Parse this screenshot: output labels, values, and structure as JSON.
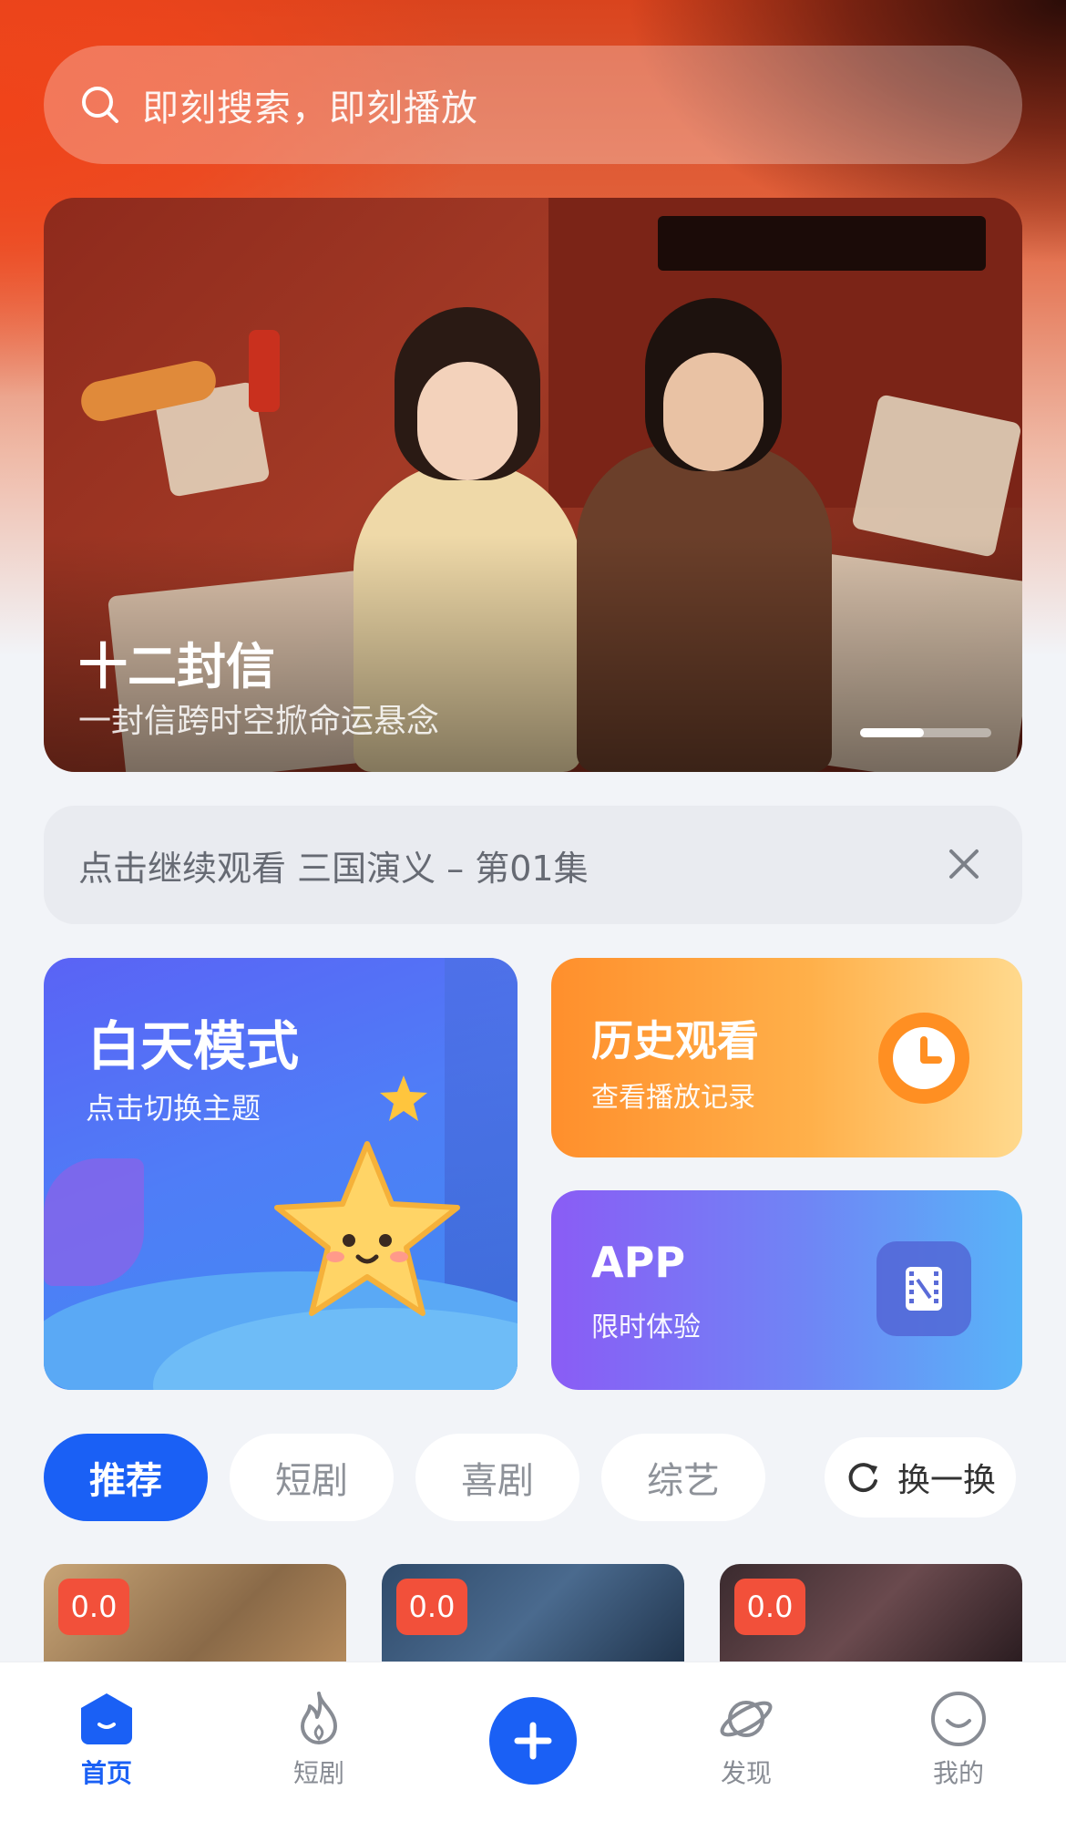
{
  "search": {
    "placeholder": "即刻搜索，即刻播放"
  },
  "banner": {
    "title": "十二封信",
    "subtitle": "一封信跨时空掀命运悬念"
  },
  "resume": {
    "text": "点击继续观看 三国演义 – 第01集"
  },
  "cards": {
    "theme": {
      "title": "白天模式",
      "subtitle": "点击切换主题"
    },
    "history": {
      "title": "历史观看",
      "subtitle": "查看播放记录"
    },
    "app": {
      "title": "APP",
      "subtitle": "限时体验"
    }
  },
  "categories": {
    "tabs": [
      "推荐",
      "短剧",
      "喜剧",
      "综艺"
    ],
    "active": "推荐",
    "refresh_label": "换一换"
  },
  "thumbnails": [
    {
      "score": "0.0"
    },
    {
      "score": "0.0"
    },
    {
      "score": "0.0"
    }
  ],
  "tabbar": {
    "items": [
      {
        "label": "首页",
        "icon": "home-icon",
        "active": true
      },
      {
        "label": "短剧",
        "icon": "flame-icon",
        "active": false
      },
      {
        "label": "",
        "icon": "plus-icon",
        "active": false
      },
      {
        "label": "发现",
        "icon": "planet-icon",
        "active": false
      },
      {
        "label": "我的",
        "icon": "smile-icon",
        "active": false
      }
    ]
  },
  "colors": {
    "accent": "#1a60f5",
    "score_badge": "#f2503a",
    "history_card": "#ff9a33",
    "theme_card": "#4f7df7"
  }
}
